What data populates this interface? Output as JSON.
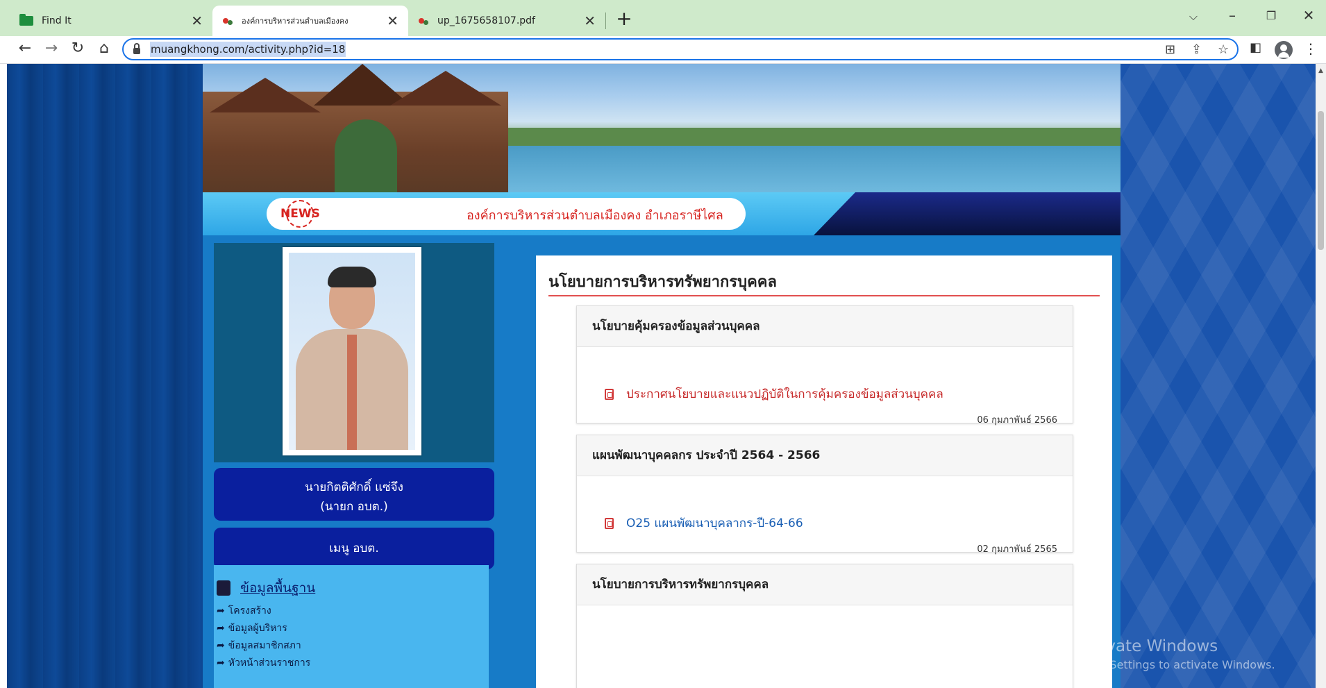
{
  "browser": {
    "tabs": [
      {
        "label": "Find It",
        "active": false,
        "icon": "folder-icon"
      },
      {
        "label": "องค์การบริหารส่วนตำบลเมืองคง",
        "active": true,
        "icon": "site-logo-icon"
      },
      {
        "label": "up_1675658107.pdf",
        "active": false,
        "icon": "site-logo-icon"
      }
    ],
    "url": "muangkhong.com/activity.php?id=18",
    "colors": {
      "tabbar": "#cfeacb",
      "omnibox_border": "#1a73e8"
    }
  },
  "header": {
    "news_logo": "NEWS",
    "org_name": "องค์การบริหารส่วนตำบลเมืองคง อำเภอราษีไศล"
  },
  "sidebar": {
    "person_name": "นายกิตติศักดิ์ แซ่จึง",
    "person_title": "(นายก อบต.)",
    "menu_title": "เมนู อบต.",
    "section_title": "ข้อมูลพื้นฐาน",
    "items": [
      {
        "label": "โครงสร้าง"
      },
      {
        "label": "ข้อมูลผู้บริหาร"
      },
      {
        "label": "ข้อมูลสมาชิกสภา"
      },
      {
        "label": "หัวหน้าส่วนราชการ"
      }
    ]
  },
  "main": {
    "title": "นโยบายการบริหารทรัพยากรบุคคล",
    "cards": [
      {
        "header": "นโยบายคุ้มครองข้อมูลส่วนบุคคล",
        "link": "ประกาศนโยบายและแนวปฏิบัติในการคุ้มครองข้อมูลส่วนบุคคล",
        "date": "06 กุมภาพันธ์ 2566"
      },
      {
        "header": "แผนพัฒนาบุคคลกร ประจำปี 2564 - 2566",
        "link": "O25 แผนพัฒนาบุคลากร-ปี-64-66",
        "date": "02 กุมภาพันธ์ 2565"
      },
      {
        "header": "นโยบายการบริหารทรัพยากรบุคคล"
      }
    ]
  },
  "watermark": {
    "line1": "Activate Windows",
    "line2": "Go to Settings to activate Windows."
  }
}
